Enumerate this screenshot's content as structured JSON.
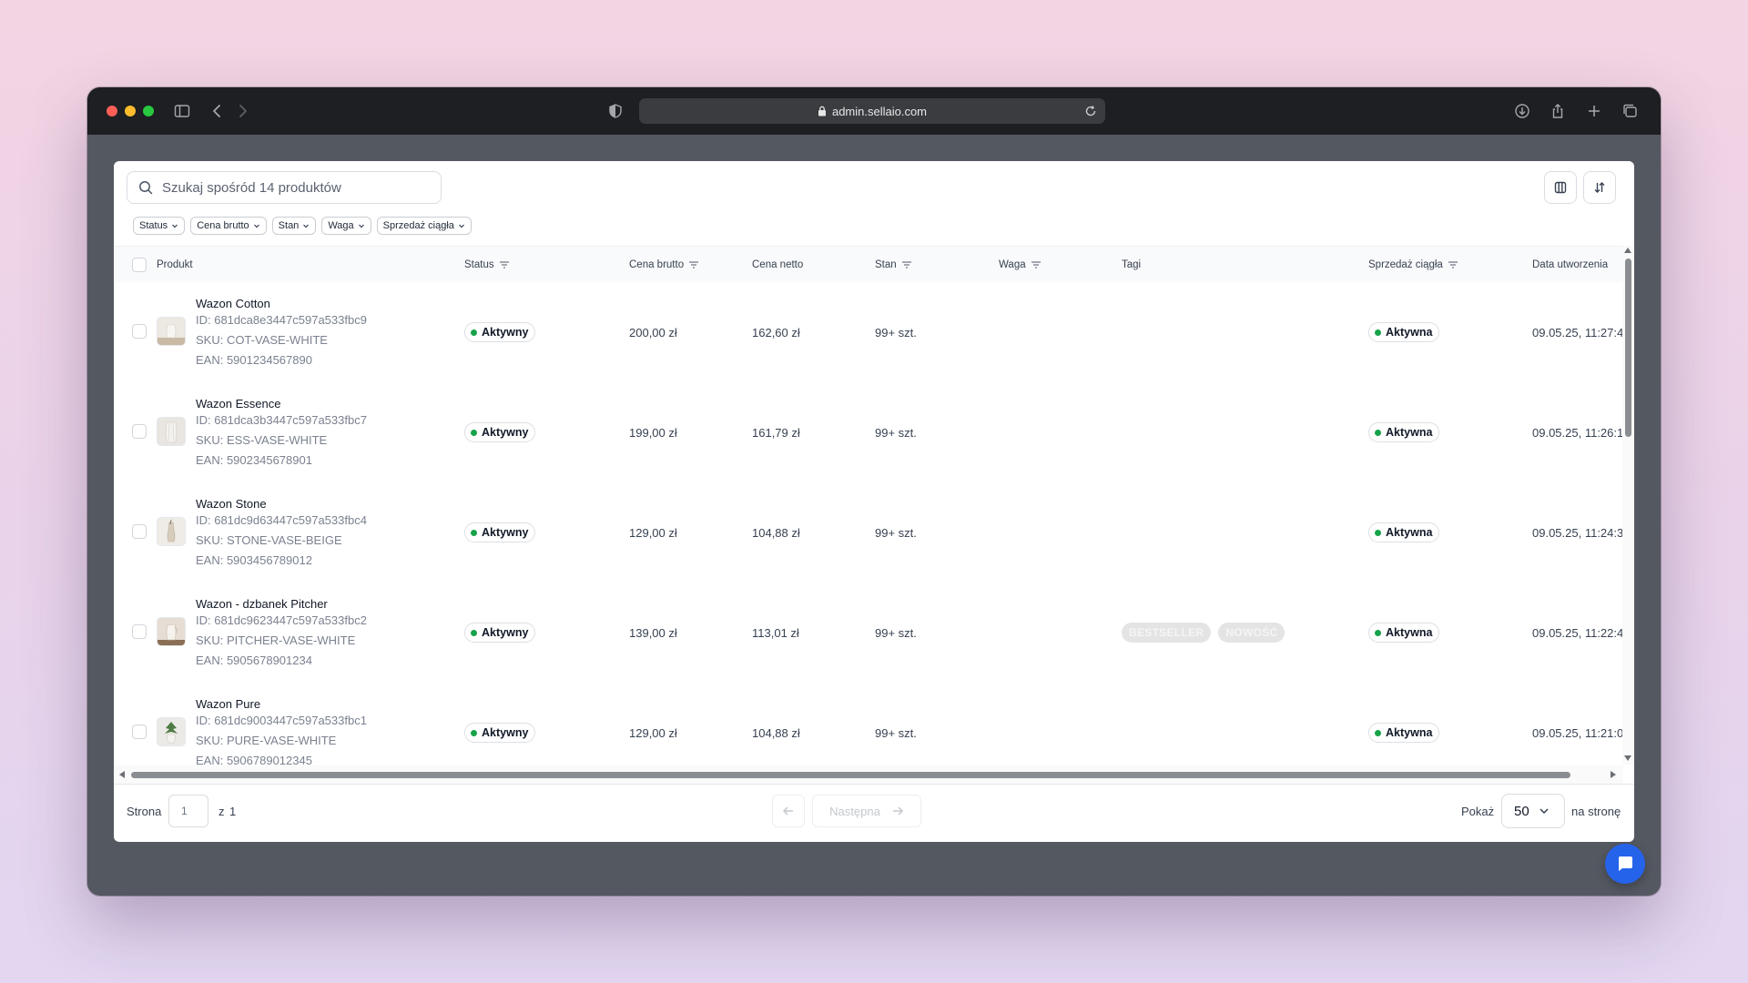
{
  "browser": {
    "url": "admin.sellaio.com"
  },
  "search": {
    "placeholder": "Szukaj spośród 14 produktów"
  },
  "filters": [
    "Status",
    "Cena brutto",
    "Stan",
    "Waga",
    "Sprzedaż ciągła"
  ],
  "columns": {
    "product": "Produkt",
    "status": "Status",
    "gross": "Cena brutto",
    "net": "Cena netto",
    "stock": "Stan",
    "weight": "Waga",
    "tags": "Tagi",
    "continuous": "Sprzedaż ciągła",
    "created": "Data utworzenia"
  },
  "rows": [
    {
      "name": "Wazon Cotton",
      "id": "ID: 681dca8e3447c597a533fbc9",
      "sku": "SKU: COT-VASE-WHITE",
      "ean": "EAN: 5901234567890",
      "status": "Aktywny",
      "gross": "200,00 zł",
      "net": "162,60 zł",
      "stock": "99+ szt.",
      "tags": [],
      "continuous": "Aktywna",
      "created": "09.05.25, 11:27:4"
    },
    {
      "name": "Wazon Essence",
      "id": "ID: 681dca3b3447c597a533fbc7",
      "sku": "SKU: ESS-VASE-WHITE",
      "ean": "EAN: 5902345678901",
      "status": "Aktywny",
      "gross": "199,00 zł",
      "net": "161,79 zł",
      "stock": "99+ szt.",
      "tags": [],
      "continuous": "Aktywna",
      "created": "09.05.25, 11:26:1"
    },
    {
      "name": "Wazon Stone",
      "id": "ID: 681dc9d63447c597a533fbc4",
      "sku": "SKU: STONE-VASE-BEIGE",
      "ean": "EAN: 5903456789012",
      "status": "Aktywny",
      "gross": "129,00 zł",
      "net": "104,88 zł",
      "stock": "99+ szt.",
      "tags": [],
      "continuous": "Aktywna",
      "created": "09.05.25, 11:24:3"
    },
    {
      "name": "Wazon - dzbanek Pitcher",
      "id": "ID: 681dc9623447c597a533fbc2",
      "sku": "SKU: PITCHER-VASE-WHITE",
      "ean": "EAN: 5905678901234",
      "status": "Aktywny",
      "gross": "139,00 zł",
      "net": "113,01 zł",
      "stock": "99+ szt.",
      "tags": [
        "BESTSELLER",
        "NOWOŚĆ"
      ],
      "continuous": "Aktywna",
      "created": "09.05.25, 11:22:4"
    },
    {
      "name": "Wazon Pure",
      "id": "ID: 681dc9003447c597a533fbc1",
      "sku": "SKU: PURE-VASE-WHITE",
      "ean": "EAN: 5906789012345",
      "status": "Aktywny",
      "gross": "129,00 zł",
      "net": "104,88 zł",
      "stock": "99+ szt.",
      "tags": [],
      "continuous": "Aktywna",
      "created": "09.05.25, 11:21:0"
    }
  ],
  "pagination": {
    "page_label": "Strona",
    "current_page": "1",
    "of_label": "z",
    "total_pages": "1",
    "next_label": "Następna",
    "show_label": "Pokaż",
    "per_page": "50",
    "per_page_suffix": "na stronę"
  },
  "colors": {
    "status_active": "#16a34a",
    "chat_button": "#2563eb"
  }
}
